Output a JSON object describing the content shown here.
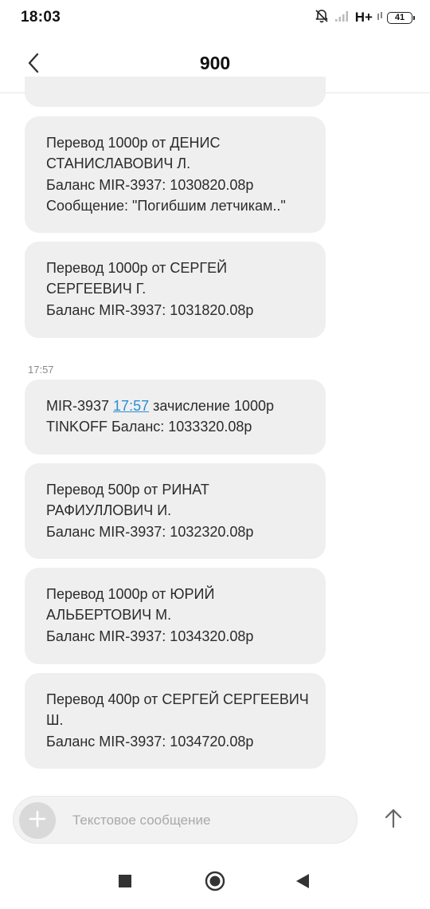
{
  "status_bar": {
    "time": "18:03",
    "network": "H+",
    "battery": "41"
  },
  "header": {
    "title": "900"
  },
  "messages": [
    {
      "lines": [
        "Перевод 1000р от ДЕНИС",
        "СТАНИСЛАВОВИЧ Л.",
        "Баланс MIR-3937: 1030820.08р",
        "Сообщение: \"Погибшим летчикам..\""
      ]
    },
    {
      "lines": [
        "Перевод 1000р от СЕРГЕЙ",
        "СЕРГЕЕВИЧ Г.",
        "Баланс MIR-3937: 1031820.08р"
      ]
    },
    {
      "prefix": "MIR-3937 ",
      "link_time": "17:57",
      "suffix": " зачисление 1000р",
      "line2": "TINKOFF Баланс: 1033320.08р"
    },
    {
      "lines": [
        "Перевод 500р от РИНАТ",
        "РАФИУЛЛОВИЧ И.",
        "Баланс MIR-3937: 1032320.08р"
      ]
    },
    {
      "lines": [
        "Перевод 1000р от ЮРИЙ",
        "АЛЬБЕРТОВИЧ М.",
        "Баланс MIR-3937: 1034320.08р"
      ]
    },
    {
      "lines": [
        "Перевод 400р от СЕРГЕЙ СЕРГЕЕВИЧ",
        "Ш.",
        "Баланс MIR-3937: 1034720.08р"
      ]
    }
  ],
  "timestamp": "17:57",
  "composer": {
    "placeholder": "Текстовое сообщение"
  },
  "icons": {
    "back": "chevron-left-icon",
    "add": "plus-icon",
    "send": "arrow-up-icon",
    "mute": "bell-off-icon",
    "signal": "signal-icon",
    "nav_recent": "square-icon",
    "nav_home": "circle-icon",
    "nav_back": "triangle-icon"
  },
  "colors": {
    "bubble_bg": "#efefef",
    "link": "#2a8fd6",
    "timestamp": "#8a8a8a",
    "placeholder": "#a9a9a9"
  }
}
